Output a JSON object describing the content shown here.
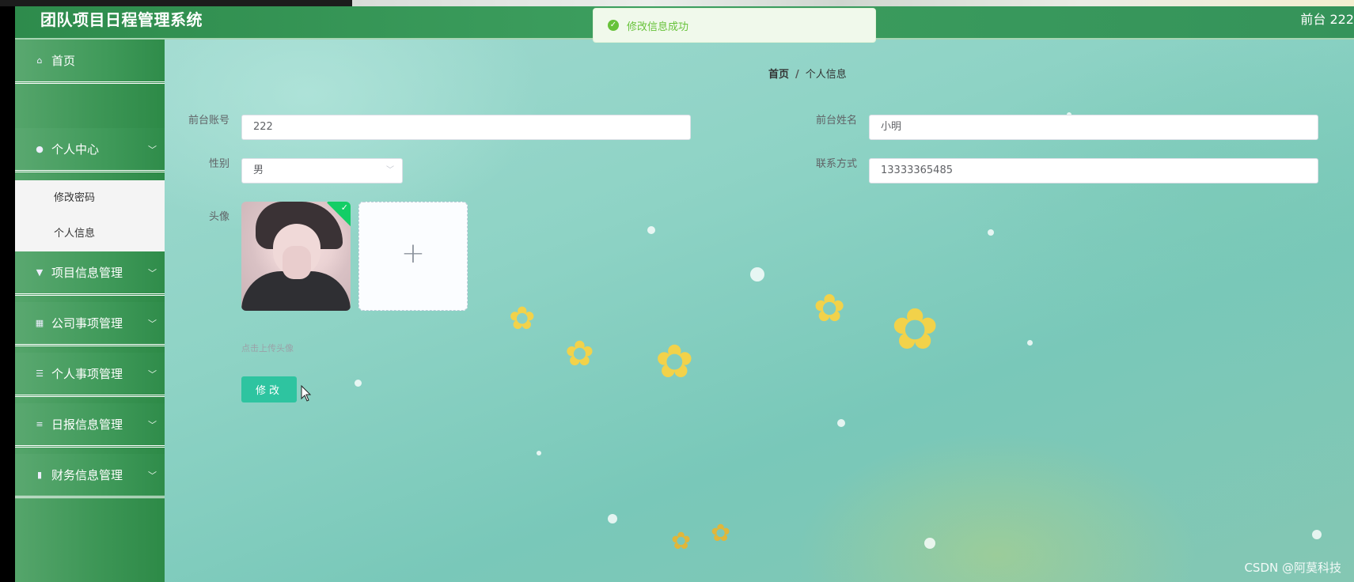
{
  "header": {
    "title": "团队项目日程管理系统",
    "user_label": "前台 222"
  },
  "toast": {
    "icon": "check-circle-icon",
    "message": "修改信息成功"
  },
  "sidebar": {
    "items": [
      {
        "label": "首页",
        "icon": "home-icon",
        "has_children": false
      },
      {
        "label": "个人中心",
        "icon": "user-icon",
        "has_children": true,
        "expanded": true,
        "children": [
          {
            "label": "修改密码"
          },
          {
            "label": "个人信息",
            "active": true
          }
        ]
      },
      {
        "label": "项目信息管理",
        "icon": "flag-icon",
        "has_children": true
      },
      {
        "label": "公司事项管理",
        "icon": "grid-icon",
        "has_children": true
      },
      {
        "label": "个人事项管理",
        "icon": "list-icon",
        "has_children": true
      },
      {
        "label": "日报信息管理",
        "icon": "sliders-icon",
        "has_children": true
      },
      {
        "label": "财务信息管理",
        "icon": "chart-icon",
        "has_children": true
      }
    ]
  },
  "breadcrumb": {
    "home": "首页",
    "separator": "/",
    "current": "个人信息"
  },
  "form": {
    "account_label": "前台账号",
    "account_value": "222",
    "name_label": "前台姓名",
    "name_value": "小明",
    "gender_label": "性别",
    "gender_value": "男",
    "phone_label": "联系方式",
    "phone_value": "13333365485",
    "avatar_label": "头像",
    "upload_plus": "+",
    "upload_tip": "点击上传头像",
    "submit_label": "修改"
  },
  "watermark": "CSDN @阿莫科技",
  "colors": {
    "header_green": "#3c9e5e",
    "success": "#67c23a",
    "button_teal": "#2ec4a0"
  }
}
